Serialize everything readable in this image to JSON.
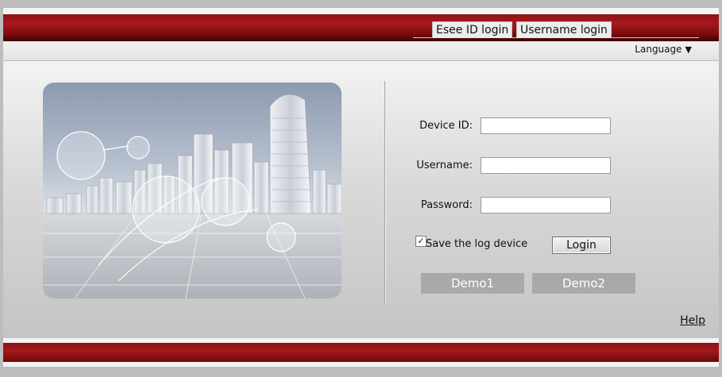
{
  "header": {
    "language_label": "Language",
    "language_arrow": "▼"
  },
  "login": {
    "tabs": [
      {
        "label": "Esee ID login"
      },
      {
        "label": "Username login"
      }
    ],
    "device_id_label": "Device ID:",
    "device_id_value": "",
    "username_label": "Username:",
    "username_value": "",
    "password_label": "Password:",
    "password_value": "",
    "save_checkbox_mark": "✓",
    "save_label": "Save the log device",
    "login_button": "Login",
    "demo_buttons": [
      {
        "label": "Demo1"
      },
      {
        "label": "Demo2"
      }
    ]
  },
  "footer": {
    "help_link": "Help"
  },
  "colors": {
    "banner_red": "#a5191d",
    "demo_button_gray": "#a9a9a9"
  }
}
